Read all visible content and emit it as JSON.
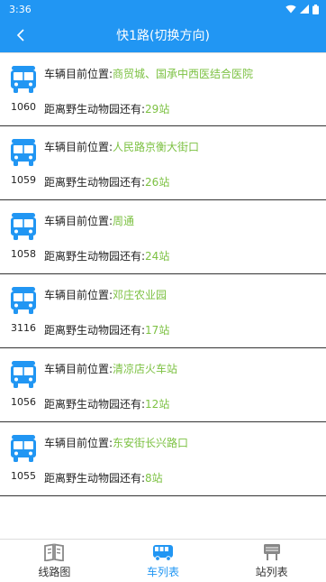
{
  "status_bar": {
    "time": "3:36"
  },
  "header": {
    "title": "快1路(切换方向)"
  },
  "buses": [
    {
      "number": "1060",
      "pos_label": "车辆目前位置:",
      "location": "商贸城、国承中西医结合医院",
      "dist_prefix": "距离野生动物园还有:",
      "dist_value": "29站"
    },
    {
      "number": "1059",
      "pos_label": "车辆目前位置:",
      "location": "人民路京衡大街口",
      "dist_prefix": "距离野生动物园还有:",
      "dist_value": "26站"
    },
    {
      "number": "1058",
      "pos_label": "车辆目前位置:",
      "location": "周通",
      "dist_prefix": "距离野生动物园还有:",
      "dist_value": "24站"
    },
    {
      "number": "3116",
      "pos_label": "车辆目前位置:",
      "location": "邓庄农业园",
      "dist_prefix": "距离野生动物园还有:",
      "dist_value": "17站"
    },
    {
      "number": "1056",
      "pos_label": "车辆目前位置:",
      "location": "清凉店火车站",
      "dist_prefix": "距离野生动物园还有:",
      "dist_value": "12站"
    },
    {
      "number": "1055",
      "pos_label": "车辆目前位置:",
      "location": "东安街长兴路口",
      "dist_prefix": "距离野生动物园还有:",
      "dist_value": "8站"
    }
  ],
  "tabs": [
    {
      "label": "线路图",
      "icon": "map-book-icon",
      "active": false
    },
    {
      "label": "车列表",
      "icon": "bus-icon",
      "active": true
    },
    {
      "label": "站列表",
      "icon": "station-sign-icon",
      "active": false
    }
  ],
  "colors": {
    "primary": "#2196f3",
    "highlight": "#7cc142",
    "bus_icon": "#2196f3",
    "inactive_icon": "#888888"
  }
}
